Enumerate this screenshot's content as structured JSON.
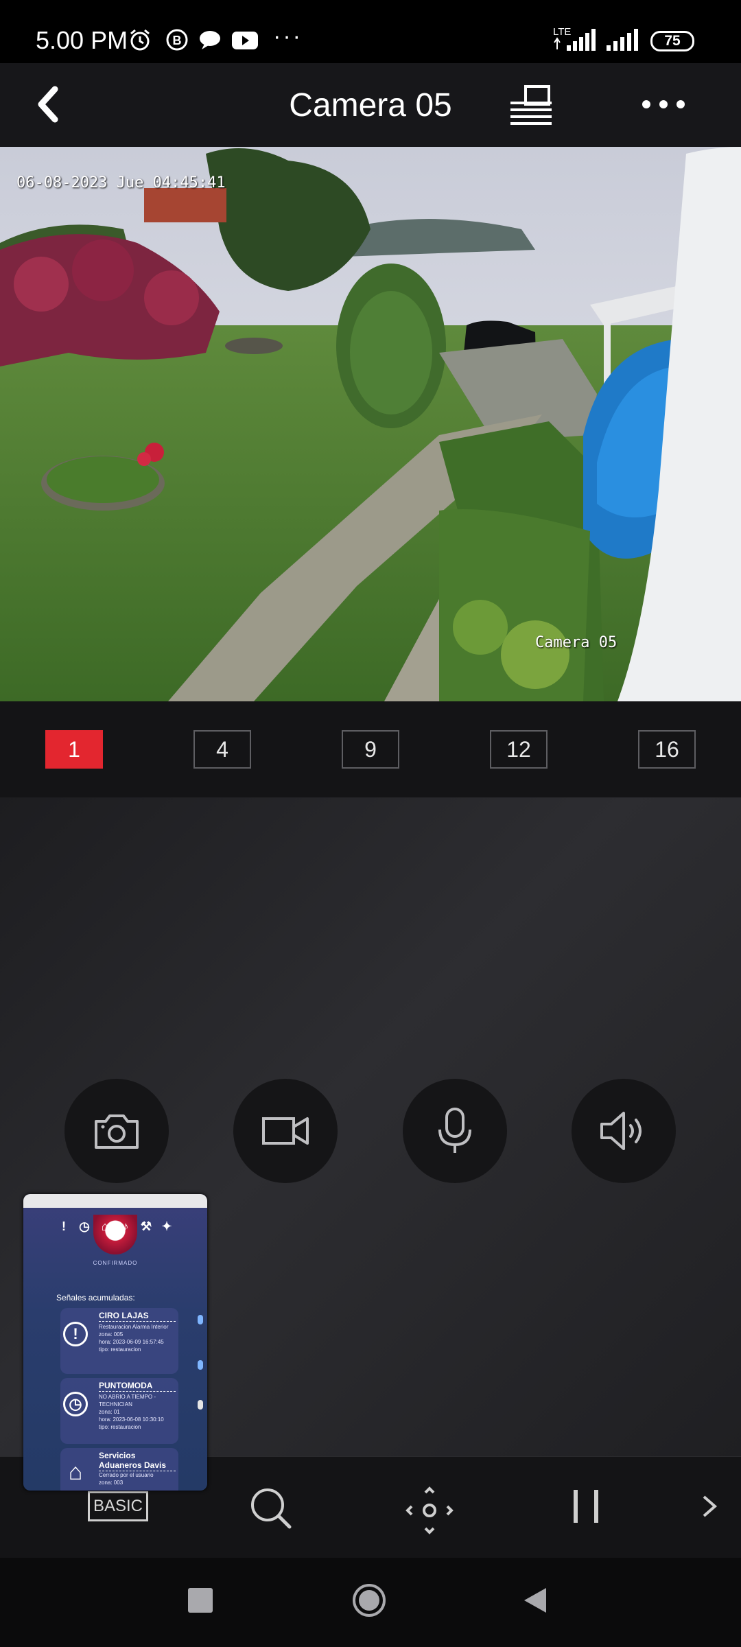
{
  "status_bar": {
    "time": "5.00 PM",
    "network": "LTE",
    "battery": "75",
    "more": "···"
  },
  "header": {
    "title": "Camera 05"
  },
  "video": {
    "osd_timestamp": "06-08-2023 Jue 04:45:41",
    "osd_camera": "Camera 05"
  },
  "split": {
    "options": [
      "1",
      "4",
      "9",
      "12",
      "16"
    ],
    "selected": "1",
    "accent": "#e3262f"
  },
  "controls": [
    "camera-icon",
    "video-record-icon",
    "microphone-icon",
    "speaker-icon"
  ],
  "toolbar": {
    "basic_label": "BASIC"
  },
  "pip": {
    "confirm": "CONFIRMADO",
    "heading": "Señales acumuladas:",
    "cards": [
      {
        "title": "CIRO LAJAS",
        "lines": [
          "Restauracion Alarma Interior",
          "zona: 005",
          "hora: 2023-06-09 16:57:45",
          "tipo: restauracion"
        ]
      },
      {
        "title": "PUNTOMODA",
        "lines": [
          "NO ABRIO A TIEMPO - TECHNICIAN",
          "zona: 01",
          "hora: 2023-06-08 10:30:10",
          "tipo: restauracion"
        ]
      },
      {
        "title": "Servicios Aduaneros Davis",
        "lines": [
          "Cerrado por el usuario",
          "zona: 003"
        ]
      }
    ]
  }
}
